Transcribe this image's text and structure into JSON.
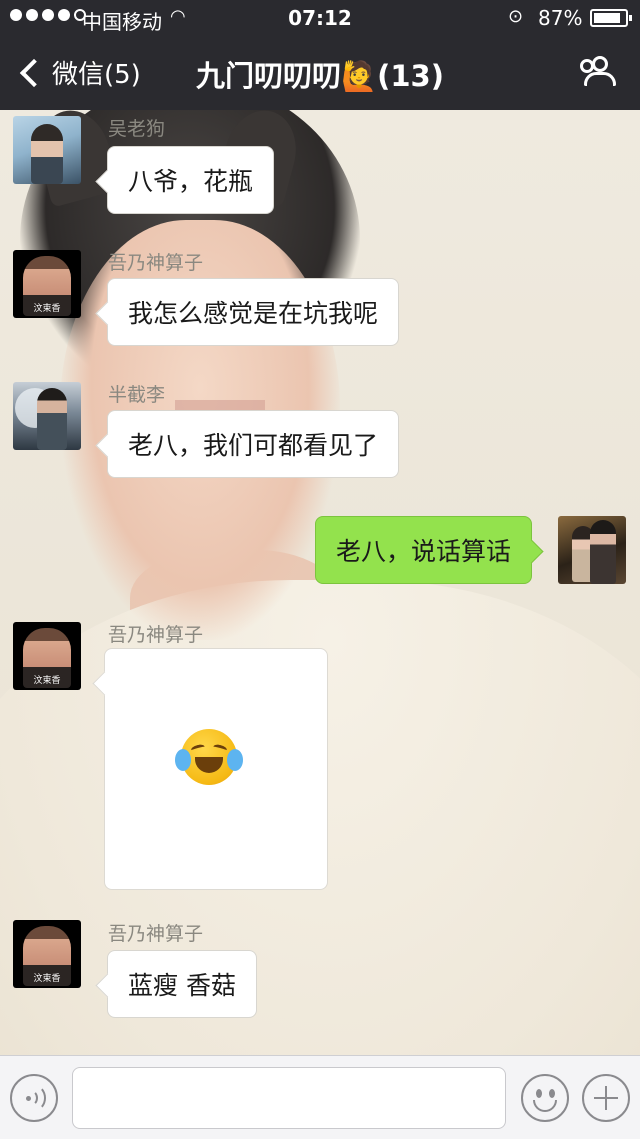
{
  "status_bar": {
    "carrier": "中国移动",
    "time": "07:12",
    "battery_percent": "87%",
    "battery_level": 0.87
  },
  "nav": {
    "back_label": "微信(5)",
    "title": "九门叨叨叨🙋(13)"
  },
  "messages": [
    {
      "sender": "吴老狗",
      "text": "八爷，花瓶",
      "avatar": "avatar-wu"
    },
    {
      "sender": "吾乃神算子",
      "text": "我怎么感觉是在坑我呢",
      "avatar": "avatar-suanzi",
      "avatar_tag": "汶束香"
    },
    {
      "sender": "半截李",
      "text": "老八，我们可都看见了",
      "avatar": "avatar-banjieli"
    },
    {
      "sender": "",
      "text": "老八，说话算话",
      "avatar": "avatar-me",
      "mine": true
    },
    {
      "sender": "吾乃神算子",
      "text": "",
      "sticker": "crying-laughing-emoji",
      "avatar": "avatar-suanzi",
      "avatar_tag": "汶束香"
    },
    {
      "sender": "吾乃神算子",
      "text": "蓝瘦 香菇",
      "avatar": "avatar-suanzi",
      "avatar_tag": "汶束香"
    }
  ],
  "input": {
    "placeholder": ""
  },
  "icons": {
    "back": "chevron-left-icon",
    "group": "group-members-icon",
    "voice": "voice-icon",
    "emoji": "emoji-icon",
    "more": "plus-icon"
  },
  "colors": {
    "nav_bg": "#2a2a2f",
    "my_bubble": "#93e24d",
    "other_bubble": "#ffffff"
  }
}
